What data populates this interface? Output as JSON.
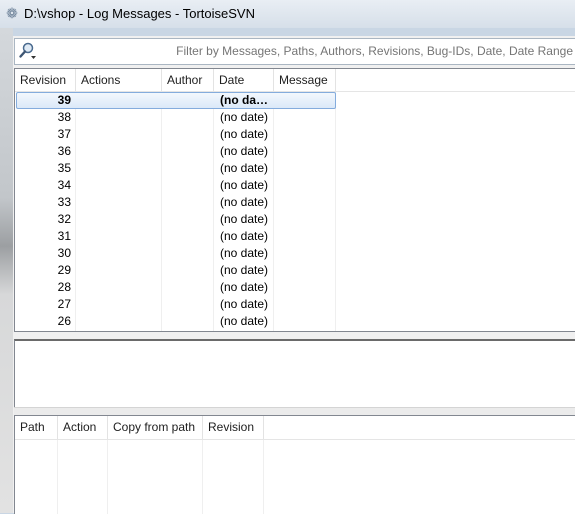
{
  "window": {
    "title": "D:\\vshop - Log Messages - TortoiseSVN"
  },
  "filter": {
    "placeholder": "Filter by Messages, Paths, Authors, Revisions, Bug-IDs, Date, Date Range"
  },
  "log": {
    "columns": [
      "Revision",
      "Actions",
      "Author",
      "Date",
      "Message"
    ],
    "rows": [
      {
        "revision": "39",
        "date": "(no da…",
        "selected": true
      },
      {
        "revision": "38",
        "date": "(no date)"
      },
      {
        "revision": "37",
        "date": "(no date)"
      },
      {
        "revision": "36",
        "date": "(no date)"
      },
      {
        "revision": "35",
        "date": "(no date)"
      },
      {
        "revision": "34",
        "date": "(no date)"
      },
      {
        "revision": "33",
        "date": "(no date)"
      },
      {
        "revision": "32",
        "date": "(no date)"
      },
      {
        "revision": "31",
        "date": "(no date)"
      },
      {
        "revision": "30",
        "date": "(no date)"
      },
      {
        "revision": "29",
        "date": "(no date)"
      },
      {
        "revision": "28",
        "date": "(no date)"
      },
      {
        "revision": "27",
        "date": "(no date)"
      },
      {
        "revision": "26",
        "date": "(no date)"
      }
    ]
  },
  "paths": {
    "columns": [
      "Path",
      "Action",
      "Copy from path",
      "Revision"
    ]
  },
  "icons": {
    "app": "tortoisesvn-icon",
    "filter": "search-dropdown-icon"
  },
  "colors": {
    "selection_border": "#84acdd",
    "selection_fill": "#dbe9f8"
  }
}
